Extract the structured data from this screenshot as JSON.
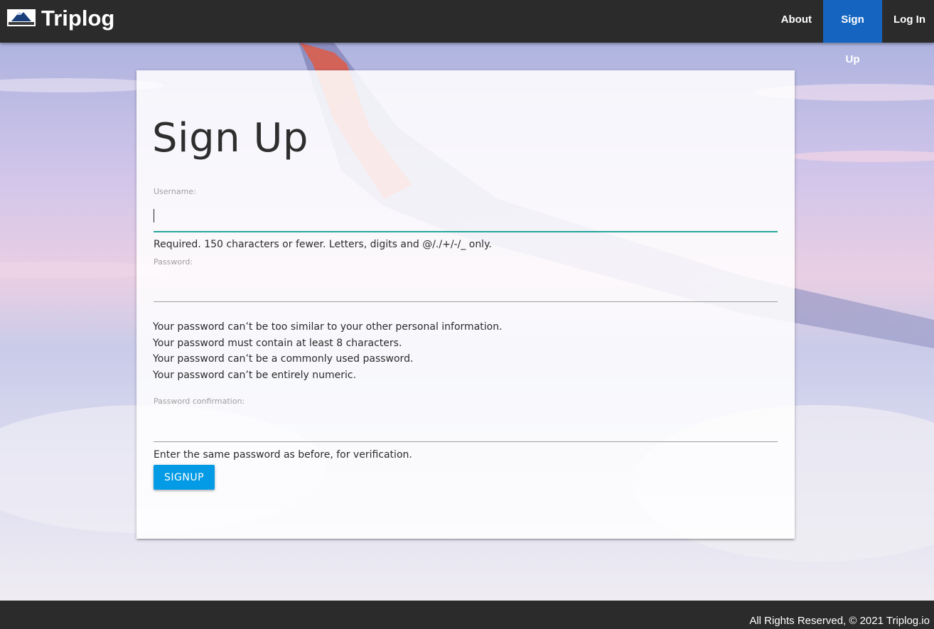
{
  "navbar": {
    "brand_name": "Triplog",
    "links": [
      {
        "label": "About",
        "active": false
      },
      {
        "label": "Sign Up",
        "active": true
      },
      {
        "label": "Log In",
        "active": false
      }
    ]
  },
  "form": {
    "title": "Sign Up",
    "username": {
      "label": "Username:",
      "value": "",
      "help": "Required. 150 characters or fewer. Letters, digits and @/./+/-/_ only."
    },
    "password": {
      "label": "Password:",
      "value": "",
      "rules": [
        "Your password can’t be too similar to your other personal information.",
        "Your password must contain at least 8 characters.",
        "Your password can’t be a commonly used password.",
        "Your password can’t be entirely numeric."
      ]
    },
    "password_confirmation": {
      "label": "Password confirmation:",
      "value": "",
      "help": "Enter the same password as before, for verification."
    },
    "submit_label": "Signup"
  },
  "footer": {
    "text": "All Rights Reserved, © 2021 Triplog.io"
  },
  "colors": {
    "navbar_bg": "#2b2b2b",
    "active_nav": "#1565c0",
    "button": "#039be5",
    "focus_underline": "#26a69a"
  }
}
